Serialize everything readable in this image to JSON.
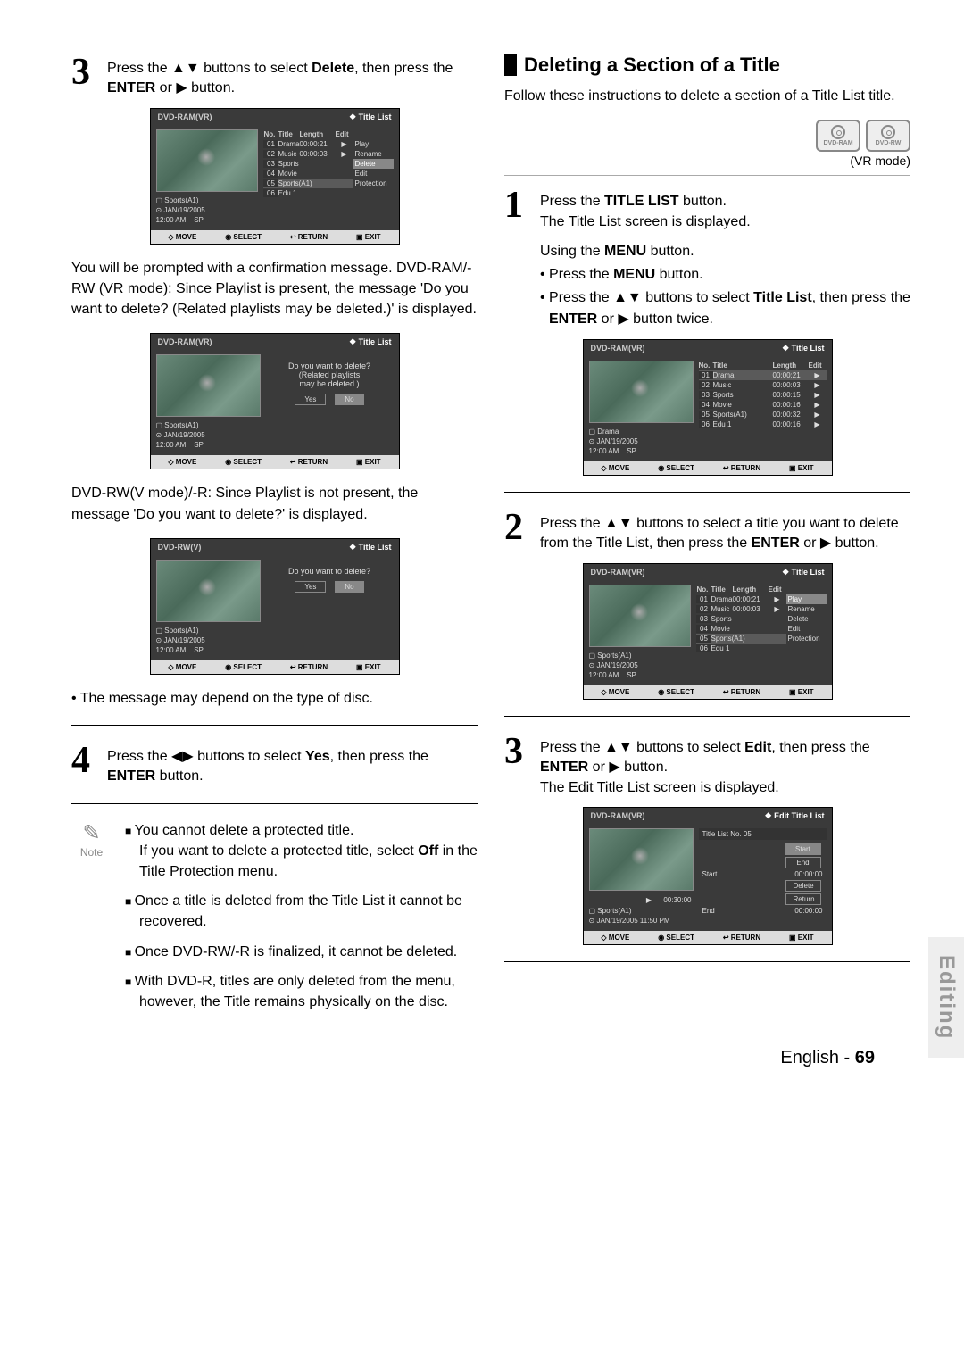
{
  "left": {
    "step3": {
      "num": "3",
      "text_a": "Press the ",
      "text_b": " buttons to select ",
      "text_c": ", then press the ",
      "text_d": " or ",
      "text_e": " button.",
      "bold1": "Delete",
      "bold2": "ENTER"
    },
    "osd1": {
      "device": "DVD-RAM(VR)",
      "title": "Title List",
      "info": {
        "name": "Sports(A1)",
        "date": "JAN/19/2005",
        "time": "12:00 AM",
        "mode": "SP"
      },
      "cols": {
        "no": "No.",
        "title": "Title",
        "len": "Length",
        "edit": "Edit"
      },
      "rows": [
        {
          "n": "01",
          "t": "Drama",
          "l": "00:00:21",
          "e": "▶"
        },
        {
          "n": "02",
          "t": "Music",
          "l": "00:00:03",
          "e": "▶"
        },
        {
          "n": "03",
          "t": "Sports",
          "l": "",
          "e": ""
        },
        {
          "n": "04",
          "t": "Movie",
          "l": "",
          "e": ""
        },
        {
          "n": "05",
          "t": "Sports(A1)",
          "l": "",
          "e": ""
        },
        {
          "n": "06",
          "t": "Edu 1",
          "l": "",
          "e": ""
        }
      ],
      "menu": [
        "Play",
        "Rename",
        "Delete",
        "Edit",
        "Protection"
      ],
      "menu_hl": 2,
      "ftr": {
        "move": "MOVE",
        "select": "SELECT",
        "return": "RETURN",
        "exit": "EXIT"
      }
    },
    "para1": "You will be prompted with a confirmation message. DVD-RAM/-RW (VR mode):  Since Playlist is present, the message 'Do you want to delete? (Related playlists may be deleted.)' is displayed.",
    "osd2": {
      "device": "DVD-RAM(VR)",
      "title": "Title List",
      "info": {
        "name": "Sports(A1)",
        "date": "JAN/19/2005",
        "time": "12:00 AM",
        "mode": "SP"
      },
      "confirm": "Do you want to delete?\n(Related playlists\nmay be deleted.)",
      "yes": "Yes",
      "no": "No"
    },
    "para2": "DVD-RW(V mode)/-R:  Since Playlist is not present, the message 'Do you want to delete?' is displayed.",
    "osd3": {
      "device": "DVD-RW(V)",
      "title": "Title List",
      "info": {
        "name": "Sports(A1)",
        "date": "JAN/19/2005",
        "time": "12:00 AM",
        "mode": "SP"
      },
      "confirm": "Do you want to delete?",
      "yes": "Yes",
      "no": "No"
    },
    "bullet1": "• The message may depend on the type of disc.",
    "step4": {
      "num": "4",
      "text_a": "Press the ",
      "text_b": " buttons to select ",
      "text_c": ", then press the ",
      "text_d": " button.",
      "bold1": "Yes",
      "bold2": "ENTER"
    },
    "note": {
      "label": "Note",
      "items": [
        "You cannot delete a protected title.\nIf you want to delete a protected title, select Off in the Title Protection menu.",
        "Once a title is deleted from the Title List it cannot be recovered.",
        "Once DVD-RW/-R is finalized, it cannot be deleted.",
        "With DVD-R, titles are only deleted from the menu, however, the Title remains physically on the disc."
      ],
      "off_bold": "Off"
    }
  },
  "right": {
    "section_title": "Deleting a Section of a Title",
    "intro": "Follow these instructions to delete a section of a Title List title.",
    "discs": [
      "DVD-RAM",
      "DVD-RW"
    ],
    "vr": "(VR mode)",
    "step1": {
      "num": "1",
      "line1a": "Press the ",
      "line1b": " button.",
      "bold1": "TITLE LIST",
      "line2": "The Title List screen is displayed."
    },
    "using": {
      "head_a": "Using the ",
      "head_b": " button.",
      "bold": "MENU",
      "b1_a": "• Press the ",
      "b1_b": " button.",
      "b2_a": "• Press the ",
      "b2_b": " buttons to select ",
      "b2_c": ", then press the ",
      "b2_d": " or ",
      "b2_e": " button twice.",
      "bold_tl": "Title List",
      "bold_enter": "ENTER"
    },
    "osdA": {
      "device": "DVD-RAM(VR)",
      "title": "Title List",
      "info": {
        "name": "Drama",
        "date": "JAN/19/2005",
        "time": "12:00 AM",
        "mode": "SP"
      },
      "rows": [
        {
          "n": "01",
          "t": "Drama",
          "l": "00:00:21",
          "e": "▶"
        },
        {
          "n": "02",
          "t": "Music",
          "l": "00:00:03",
          "e": "▶"
        },
        {
          "n": "03",
          "t": "Sports",
          "l": "00:00:15",
          "e": "▶"
        },
        {
          "n": "04",
          "t": "Movie",
          "l": "00:00:16",
          "e": "▶"
        },
        {
          "n": "05",
          "t": "Sports(A1)",
          "l": "00:00:32",
          "e": "▶"
        },
        {
          "n": "06",
          "t": "Edu 1",
          "l": "00:00:16",
          "e": "▶"
        }
      ]
    },
    "step2": {
      "num": "2",
      "text_a": "Press the ",
      "text_b": " buttons to select a title you want to delete from the Title List, then press the ",
      "text_c": " or ",
      "text_d": " button.",
      "bold_enter": "ENTER"
    },
    "osdB": {
      "device": "DVD-RAM(VR)",
      "title": "Title List",
      "info": {
        "name": "Sports(A1)",
        "date": "JAN/19/2005",
        "time": "12:00 AM",
        "mode": "SP"
      },
      "rows": [
        {
          "n": "01",
          "t": "Drama",
          "l": "00:00:21",
          "e": "▶"
        },
        {
          "n": "02",
          "t": "Music",
          "l": "00:00:03",
          "e": "▶"
        },
        {
          "n": "03",
          "t": "Sports",
          "l": "",
          "e": ""
        },
        {
          "n": "04",
          "t": "Movie",
          "l": "",
          "e": ""
        },
        {
          "n": "05",
          "t": "Sports(A1)",
          "l": "",
          "e": ""
        },
        {
          "n": "06",
          "t": "Edu 1",
          "l": "",
          "e": ""
        }
      ],
      "menu": [
        "Play",
        "Rename",
        "Delete",
        "Edit",
        "Protection"
      ],
      "menu_hl": 0
    },
    "step3": {
      "num": "3",
      "text_a": "Press the ",
      "text_b": " buttons to select ",
      "text_c": ", then press the ",
      "text_d": " or ",
      "text_e": " button.",
      "bold_edit": "Edit",
      "bold_enter": "ENTER",
      "line2": "The Edit Title List screen is displayed."
    },
    "osdC": {
      "device": "DVD-RAM(VR)",
      "title": "Edit Title List",
      "subtitle": "Title List No. 05",
      "info": {
        "name": "Sports(A1)",
        "date": "JAN/19/2005 11:50 PM"
      },
      "time_dur": "00:30:00",
      "start_lbl": "Start",
      "start_val": "00:00:00",
      "end_lbl": "End",
      "end_val": "00:00:00",
      "btns": [
        "Start",
        "End",
        "Delete",
        "Return"
      ]
    }
  },
  "side_tab": "Editing",
  "footer": {
    "lang": "English",
    "sep": " - ",
    "page": "69"
  },
  "ftr_labels": {
    "move": "MOVE",
    "select": "SELECT",
    "return": "RETURN",
    "exit": "EXIT"
  },
  "cols": {
    "no": "No.",
    "title": "Title",
    "len": "Length",
    "edit": "Edit"
  },
  "glyphs": {
    "updown": "▲▼",
    "leftright": "◀▶",
    "right": "▶"
  }
}
